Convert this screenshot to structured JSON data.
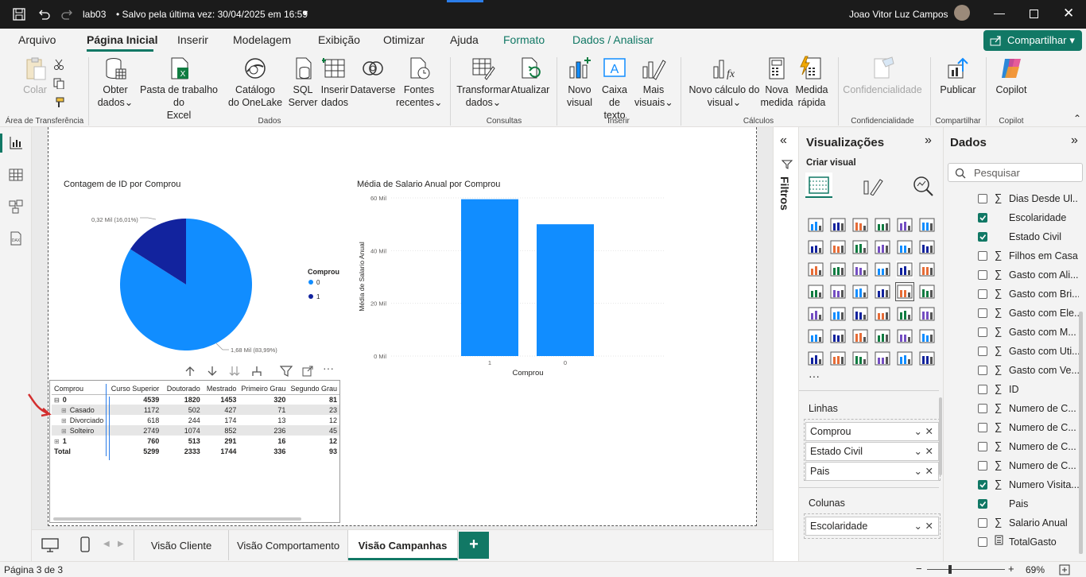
{
  "titlebar": {
    "file_name": "lab03",
    "save_status": "• Salvo pela última vez: 30/04/2025 em 16:59",
    "user_name": "Joao Vitor Luz Campos"
  },
  "ribbon_tabs": [
    "Arquivo",
    "Página Inicial",
    "Inserir",
    "Modelagem",
    "Exibição",
    "Otimizar",
    "Ajuda",
    "Formato",
    "Dados / Analisar"
  ],
  "share_label": "Compartilhar",
  "ribbon": {
    "clipboard": {
      "paste": "Colar",
      "group": "Área de Transferência"
    },
    "data": {
      "get_data": [
        "Obter",
        "dados"
      ],
      "excel": [
        "Pasta de trabalho do",
        "Excel"
      ],
      "onelake": [
        "Catálogo",
        "do OneLake"
      ],
      "sql": [
        "SQL",
        "Server"
      ],
      "enter_data": [
        "Inserir",
        "dados"
      ],
      "dataverse": "Dataverse",
      "recent": [
        "Fontes",
        "recentes"
      ],
      "group": "Dados"
    },
    "queries": {
      "transform": [
        "Transformar",
        "dados"
      ],
      "refresh": "Atualizar",
      "group": "Consultas"
    },
    "insert": {
      "new_visual": [
        "Novo",
        "visual"
      ],
      "text_box": [
        "Caixa de",
        "texto"
      ],
      "more_visuals": [
        "Mais",
        "visuais"
      ],
      "group": "Inserir"
    },
    "calc": {
      "new_calc": [
        "Novo cálculo do",
        "visual"
      ],
      "new_measure": [
        "Nova",
        "medida"
      ],
      "quick_measure": [
        "Medida",
        "rápida"
      ],
      "group": "Cálculos"
    },
    "sensitivity": {
      "label": "Confidencialidade",
      "group": "Confidencialidade"
    },
    "share": {
      "publish": "Publicar",
      "group": "Compartilhar"
    },
    "copilot": {
      "label": "Copilot",
      "group": "Copilot"
    }
  },
  "pie_chart": {
    "title": "Contagem de ID por Comprou",
    "legend_title": "Comprou",
    "label_small": "0,32 Mil (16,01%)",
    "label_large": "1,68 Mil (83,99%)",
    "colors": [
      "#118dff",
      "#12239e"
    ]
  },
  "bar_chart": {
    "title": "Média de Salario Anual por Comprou",
    "xlabel": "Comprou",
    "ylabel": "Média de Salario Anual",
    "ticks": [
      "60 Mil",
      "40 Mil",
      "20 Mil",
      "0 Mil"
    ],
    "color": "#118dff"
  },
  "chart_data": [
    {
      "type": "pie",
      "title": "Contagem de ID por Comprou",
      "legend": [
        "0",
        "1"
      ],
      "categories": [
        "0",
        "1"
      ],
      "values": [
        1680,
        320
      ],
      "percentages": [
        83.99,
        16.01
      ]
    },
    {
      "type": "bar",
      "title": "Média de Salario Anual por Comprou",
      "categories": [
        "1",
        "0"
      ],
      "values": [
        59500,
        50000
      ],
      "xlabel": "Comprou",
      "ylabel": "Média de Salario Anual",
      "ylim": [
        0,
        60000
      ]
    }
  ],
  "matrix": {
    "headers": [
      "Comprou",
      "Curso Superior",
      "Doutorado",
      "Mestrado",
      "Primeiro Grau",
      "Segundo Grau"
    ],
    "rows": [
      {
        "label": "0",
        "level": 0,
        "values": [
          "4539",
          "1820",
          "1453",
          "320",
          "81"
        ]
      },
      {
        "label": "Casado",
        "level": 1,
        "values": [
          "1172",
          "502",
          "427",
          "71",
          "23"
        ]
      },
      {
        "label": "Divorciado",
        "level": 1,
        "values": [
          "618",
          "244",
          "174",
          "13",
          "12"
        ]
      },
      {
        "label": "Solteiro",
        "level": 1,
        "values": [
          "2749",
          "1074",
          "852",
          "236",
          "45"
        ]
      },
      {
        "label": "1",
        "level": 0,
        "values": [
          "760",
          "513",
          "291",
          "16",
          "12"
        ]
      },
      {
        "label": "Total",
        "level": 0,
        "values": [
          "5299",
          "2333",
          "1744",
          "336",
          "93"
        ]
      }
    ]
  },
  "page_tabs": [
    "Visão Cliente",
    "Visão Comportamento",
    "Visão Campanhas"
  ],
  "status": {
    "page": "Página 3 de 3",
    "zoom": "69%"
  },
  "filters_label": "Filtros",
  "viz_pane": {
    "title": "Visualizações",
    "create_visual": "Criar visual",
    "rows_label": "Linhas",
    "rows": [
      "Comprou",
      "Estado Civil",
      "Pais"
    ],
    "columns_label": "Colunas",
    "columns": [
      "Escolaridade"
    ]
  },
  "data_pane": {
    "title": "Dados",
    "search_placeholder": "Pesquisar",
    "fields": [
      {
        "name": "Dias Desde Ul...",
        "sigma": true,
        "checked": false
      },
      {
        "name": "Escolaridade",
        "sigma": false,
        "checked": true
      },
      {
        "name": "Estado Civil",
        "sigma": false,
        "checked": true
      },
      {
        "name": "Filhos em Casa",
        "sigma": true,
        "checked": false
      },
      {
        "name": "Gasto com Ali...",
        "sigma": true,
        "checked": false
      },
      {
        "name": "Gasto com Bri...",
        "sigma": true,
        "checked": false
      },
      {
        "name": "Gasto com Ele...",
        "sigma": true,
        "checked": false
      },
      {
        "name": "Gasto com M...",
        "sigma": true,
        "checked": false
      },
      {
        "name": "Gasto com Uti...",
        "sigma": true,
        "checked": false
      },
      {
        "name": "Gasto com Ve...",
        "sigma": true,
        "checked": false
      },
      {
        "name": "ID",
        "sigma": true,
        "checked": false
      },
      {
        "name": "Numero de C...",
        "sigma": true,
        "checked": false
      },
      {
        "name": "Numero de C...",
        "sigma": true,
        "checked": false
      },
      {
        "name": "Numero de C...",
        "sigma": true,
        "checked": false
      },
      {
        "name": "Numero de C...",
        "sigma": true,
        "checked": false
      },
      {
        "name": "Numero Visita...",
        "sigma": true,
        "checked": true
      },
      {
        "name": "Pais",
        "sigma": false,
        "checked": true
      },
      {
        "name": "Salario Anual",
        "sigma": true,
        "checked": false
      },
      {
        "name": "TotalGasto",
        "sigma": false,
        "checked": false
      }
    ]
  }
}
